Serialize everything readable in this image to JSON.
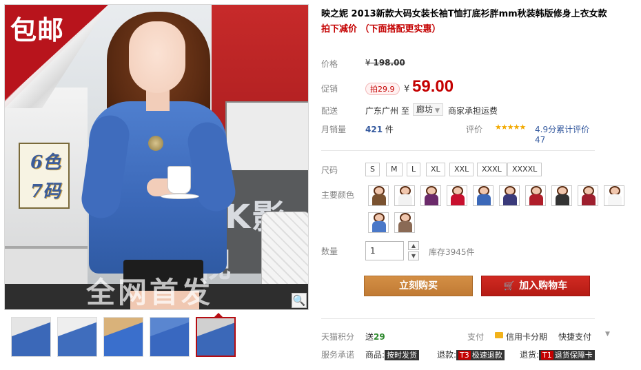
{
  "gallery": {
    "badge_free_shipping": "包邮",
    "colors_badge_line1": "6色",
    "colors_badge_line2": "7码",
    "wall_sign": "AK影视",
    "watermark": "全网首发",
    "zoom_icon": "magnifier-icon",
    "thumbnails": [
      {
        "colors": [
          "#3b68b8",
          "#e5e5e5"
        ]
      },
      {
        "colors": [
          "#3f6dbd",
          "#eeeeee"
        ]
      },
      {
        "colors": [
          "#3a6fcc",
          "#d9b27a"
        ]
      },
      {
        "colors": [
          "#3968c0",
          "#5a86d0"
        ]
      },
      {
        "colors": [
          "#3b68b8",
          "#d0d0d0"
        ],
        "active": true
      }
    ]
  },
  "product": {
    "title": "映之妮 2013新款大码女装长袖T恤打底衫胖mm秋装韩版修身上衣女款",
    "promo_line": "拍下减价 （下面搭配更实惠）"
  },
  "price": {
    "label": "价格",
    "currency": "¥",
    "original": "198.00"
  },
  "sale": {
    "label": "促销",
    "tag": "拍29.9",
    "currency": "¥",
    "price": "59.00"
  },
  "shipping": {
    "label": "配送",
    "from": "广东广州",
    "to_label": "至",
    "destination": "廊坊",
    "cost": "商家承担运费"
  },
  "sales": {
    "label": "月销量",
    "count": "421",
    "unit": "件",
    "rating_label": "评价",
    "stars": "★★★★★",
    "rating_text": "4.9分累计评价47"
  },
  "options": {
    "size_label": "尺码",
    "sizes": [
      "S",
      "M",
      "L",
      "XL",
      "XXL",
      "XXXL",
      "XXXXL"
    ],
    "color_label": "主要颜色",
    "colors": [
      "#7a5230",
      "#f2f2f2",
      "#6b2a6a",
      "#c8102e",
      "#3b68b8",
      "#3a3a7a",
      "#b01e2a",
      "#333333",
      "#9e1f2e",
      "#f6f6f6",
      "#d0205a",
      "#4a78c8",
      "#8a6a55"
    ]
  },
  "quantity": {
    "label": "数量",
    "value": "1",
    "stock": "库存3945件"
  },
  "actions": {
    "buy_now": "立刻购买",
    "add_to_cart": "加入购物车",
    "cart_icon": "cart-icon"
  },
  "points": {
    "label": "天猫积分",
    "prefix": "送",
    "value": "29"
  },
  "payment": {
    "label": "支付",
    "card": "信用卡分期",
    "fast": "快捷支付"
  },
  "service": {
    "label": "服务承诺",
    "goods_prefix": "商品:",
    "goods_tag": "按时发货",
    "refund_prefix": "退款:",
    "refund_tag_t": "T3",
    "refund_tag": "极速退款",
    "return_prefix": "退货:",
    "return_tag_t": "T1",
    "return_tag": "退货保障卡"
  }
}
